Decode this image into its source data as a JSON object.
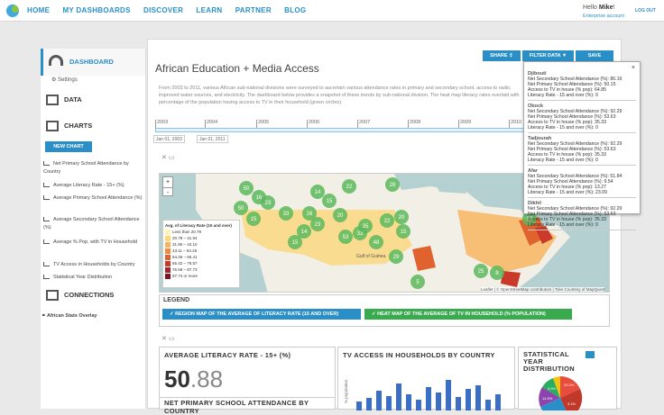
{
  "nav": {
    "items": [
      "HOME",
      "MY DASHBOARDS",
      "DISCOVER",
      "LEARN",
      "PARTNER",
      "BLOG"
    ],
    "hello": "Hello ",
    "user": "Mike",
    "user_mark": "!",
    "account": "Enterprise account",
    "logout": "LOG OUT"
  },
  "sidebar": {
    "dashboard": "DASHBOARD",
    "settings": "Settings",
    "data": "DATA",
    "charts": "CHARTS",
    "new_chart": "NEW CHART",
    "chart_items": [
      "Net Primary School Attendance by Country",
      "Average Literacy Rate - 15+ (%)",
      "Average Primary School Attendance (%)",
      "Average Secondary School Attendance (%)",
      "Average % Pop. with TV in Household",
      "TV Access in Households by Country",
      "Statistical Year Distribution"
    ],
    "connections": "CONNECTIONS",
    "overlay": "African Stats Overlay"
  },
  "main": {
    "title": "African Education + Media Access",
    "description": "From 2003 to 2011, various African sub-national divisions were surveyed to ascertain various attendance rates in primary and secondary school, access to radio, improved water sources, and electricity. The dashboard below provides a snapshot of these trends by sub-national division. The heat map literacy rates overlaid with percentage of the population having access to TV in their household (green circles).",
    "share": "SHARE",
    "filter": "FILTER DATA",
    "save": "SAVE",
    "years": [
      "2003",
      "2004",
      "2005",
      "2006",
      "2007",
      "2008",
      "2009",
      "2010"
    ],
    "date_from": "Jan 01, 2003",
    "date_to": "Jan 01, 2011"
  },
  "map": {
    "zoom_in": "+",
    "zoom_out": "-",
    "legend_title": "Avg. of Literacy Rate (15 and over)",
    "legend": [
      {
        "label": "Less than 20.79",
        "color": "#fff3b0"
      },
      {
        "label": "20.79 – 31.94",
        "color": "#fbd77a"
      },
      {
        "label": "31.95 – 43.10",
        "color": "#f7b25a"
      },
      {
        "label": "43.11 – 54.25",
        "color": "#f08a3e"
      },
      {
        "label": "54.26 – 65.41",
        "color": "#e0622f"
      },
      {
        "label": "65.42 – 76.57",
        "color": "#c93a2a"
      },
      {
        "label": "76.58 – 87.73",
        "color": "#a8232a"
      },
      {
        "label": "87.74 or more",
        "color": "#7d1525"
      }
    ],
    "attribution": "Leaflet | © OpenStreetMap contributors | Tiles Courtesy of MapQuest",
    "gulf": "Gulf of Guinea",
    "clusters": [
      "50",
      "16",
      "14",
      "22",
      "28",
      "15",
      "50",
      "23",
      "33",
      "15",
      "14",
      "23",
      "20",
      "53",
      "33",
      "22",
      "20",
      "15",
      "48",
      "29",
      "35",
      "15",
      "26",
      "38",
      "8",
      "5",
      "25"
    ]
  },
  "legend_section": {
    "title": "LEGEND",
    "item1": "REGION MAP OF THE AVERAGE OF LITERACY RATE (15 AND OVER)",
    "item2": "HEAT MAP OF THE AVERAGE OF TV IN HOUSEHOLD (% POPULATION)"
  },
  "panels": {
    "literacy_title": "AVERAGE LITERACY RATE - 15+ (%)",
    "literacy_whole": "50",
    "literacy_decimal": ".88",
    "tv_title": "TV ACCESS IN HOUSEHOLDS BY COUNTRY",
    "tv_axis": "% population",
    "netprim_title": "NET PRIMARY SCHOOL ATTENDANCE BY COUNTRY",
    "stat_title": "STATISTICAL YEAR DISTRIBUTION",
    "pie_labels": [
      "20.2%",
      "3.5%",
      "14.5%",
      "3.1%"
    ]
  },
  "popup": {
    "close": "×",
    "entries": [
      {
        "name": "Djibouti",
        "lines": [
          "Net Secondary School Attendance (%): 86.16",
          "Net Primary School Attendance (%): 50.15",
          "Access to TV in house (% pop): 64.85",
          "Literacy Rate - 15 and over (%): 0"
        ]
      },
      {
        "name": "Obock",
        "lines": [
          "Net Secondary School Attendance (%): 92.29",
          "Net Primary School Attendance (%): 53.63",
          "Access to TV in house (% pop): 35.33",
          "Literacy Rate - 15 and over (%): 0"
        ]
      },
      {
        "name": "Tadjourah",
        "lines": [
          "Net Secondary School Attendance (%): 92.29",
          "Net Primary School Attendance (%): 53.63",
          "Access to TV in house (% pop): 35.33",
          "Literacy Rate - 15 and over (%): 0"
        ]
      },
      {
        "name": "Afar",
        "lines": [
          "Net Secondary School Attendance (%): 51.84",
          "Net Primary School Attendance (%): 9.54",
          "Access to TV in house (% pop): 13.27",
          "Literacy Rate - 15 and over (%): 23.09"
        ]
      },
      {
        "name": "Dikhil",
        "lines": [
          "Net Secondary School Attendance (%): 92.29",
          "Net Primary School Attendance (%): 53.63",
          "Access to TV in house (% pop): 35.33",
          "Literacy Rate - 15 and over (%): 0"
        ]
      }
    ]
  },
  "colors": {
    "accent": "#2b8fc7",
    "green": "#3aaa4f"
  }
}
